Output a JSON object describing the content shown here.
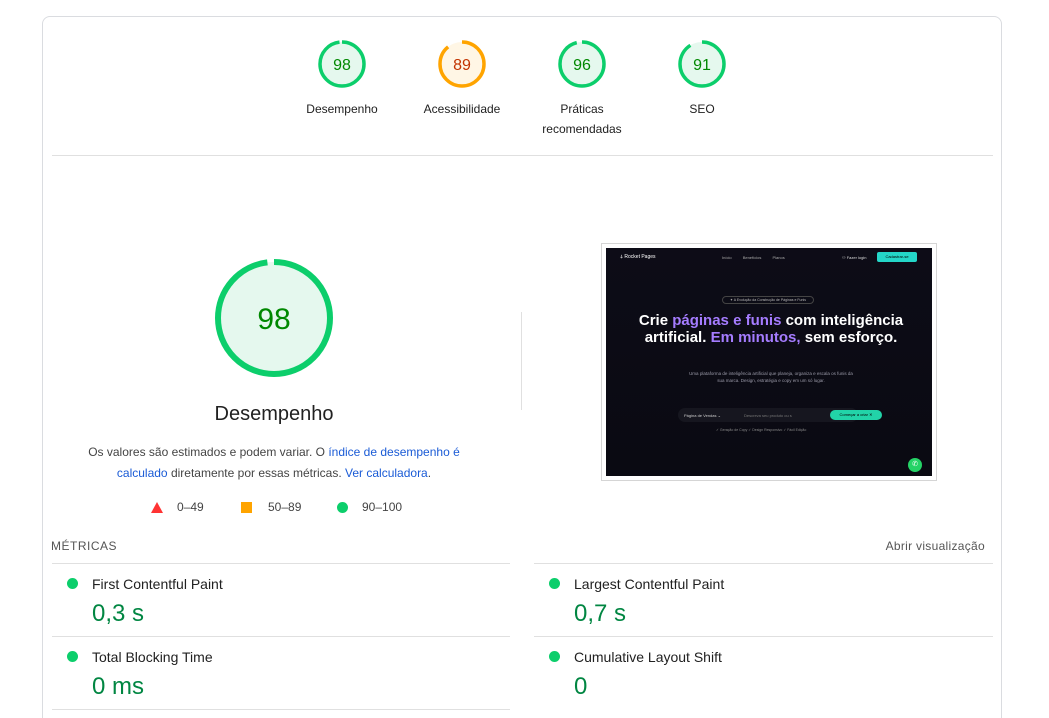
{
  "gauges": [
    {
      "score": "98",
      "label": "Desempenho",
      "level": "pass",
      "value": 0.98
    },
    {
      "score": "89",
      "label": "Acessibilidade",
      "level": "average",
      "value": 0.89
    },
    {
      "score": "96",
      "label_line1": "Práticas",
      "label_line2": "recomendadas",
      "level": "pass",
      "value": 0.96
    },
    {
      "score": "91",
      "label": "SEO",
      "level": "pass",
      "value": 0.91
    }
  ],
  "colors": {
    "pass": "#0cce6b",
    "pass_text": "#008800",
    "pass_bg": "#e5f8ee",
    "average": "#ffa400",
    "average_text": "#c33300",
    "average_bg": "#fff6e5",
    "fail": "#ff3333"
  },
  "performance": {
    "score": "98",
    "title": "Desempenho",
    "desc_part1": "Os valores são estimados e podem variar. O ",
    "desc_link1": "índice de desempenho é calculado",
    "desc_part2": " diretamente por essas métricas. ",
    "desc_link2": "Ver calculadora",
    "desc_part3": "."
  },
  "legend": {
    "fail": "0–49",
    "average": "50–89",
    "pass": "90–100"
  },
  "thumbnail": {
    "brand": "Rocket Pages",
    "nav_links": [
      "Início",
      "Benefícios",
      "Planos"
    ],
    "login": "Fazer login",
    "cta": "Cadastrar-se",
    "pill": "✦ A Evolução da Construção de Páginas e Funis",
    "h1_a": "Crie ",
    "h1_b": "páginas e funis",
    "h1_c": " com inteligência artificial. ",
    "h1_d": "Em minutos,",
    "h1_e": " sem esforço.",
    "sub": "Uma plataforma de inteligência artificial que planeja, organiza e escala os funis da sua marca. Design, estratégia e copy em um só lugar.",
    "select": "Página de Vendas",
    "placeholder": "Descreva seu produto ou s",
    "go": "Começar a criar",
    "foot": "✓ Geração de Copy  ✓ Design Responsivo  ✓ Fácil Edição"
  },
  "metrics": {
    "heading": "MÉTRICAS",
    "toggle": "Abrir visualização",
    "items": [
      {
        "name": "First Contentful Paint",
        "value": "0,3 s"
      },
      {
        "name": "Largest Contentful Paint",
        "value": "0,7 s"
      },
      {
        "name": "Total Blocking Time",
        "value": "0 ms"
      },
      {
        "name": "Cumulative Layout Shift",
        "value": "0"
      }
    ]
  }
}
